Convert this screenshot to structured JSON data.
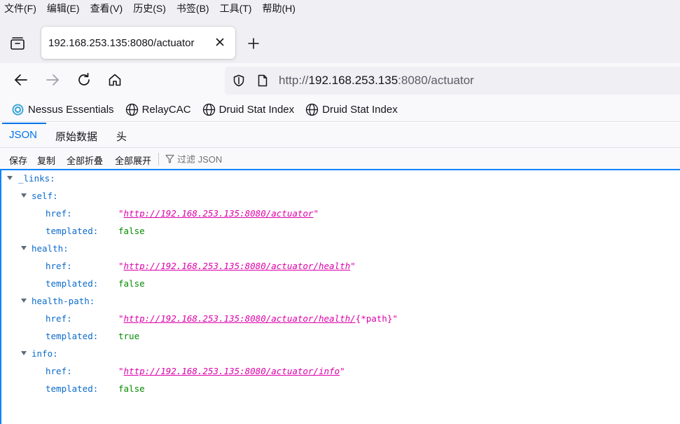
{
  "menubar": [
    "文件(F)",
    "编辑(E)",
    "查看(V)",
    "历史(S)",
    "书签(B)",
    "工具(T)",
    "帮助(H)"
  ],
  "tab": {
    "title": "192.168.253.135:8080/actuator"
  },
  "urlbar": {
    "scheme": "http://",
    "host": "192.168.253.135",
    "rest": ":8080/actuator"
  },
  "bookmarks": [
    {
      "label": "Nessus Essentials",
      "icon": "nessus-icon"
    },
    {
      "label": "RelayCAC",
      "icon": "globe-icon"
    },
    {
      "label": "Druid Stat Index",
      "icon": "globe-icon"
    },
    {
      "label": "Druid Stat Index",
      "icon": "globe-icon"
    }
  ],
  "viewer_tabs": [
    "JSON",
    "原始数据",
    "头"
  ],
  "toolbar": {
    "save": "保存",
    "copy": "复制",
    "collapse_all": "全部折叠",
    "expand_all": "全部展开",
    "filter_placeholder": "过滤 JSON"
  },
  "json": {
    "root_key": "_links:",
    "groups": [
      {
        "key": "self:",
        "href": "http://192.168.253.135:8080/actuator",
        "href_suffix": "",
        "templated": "false"
      },
      {
        "key": "health:",
        "href": "http://192.168.253.135:8080/actuator/health",
        "href_suffix": "",
        "templated": "false"
      },
      {
        "key": "health-path:",
        "href": "http://192.168.253.135:8080/actuator/health/",
        "href_suffix": "{*path}",
        "templated": "true"
      },
      {
        "key": "info:",
        "href": "http://192.168.253.135:8080/actuator/info",
        "href_suffix": "",
        "templated": "false"
      }
    ],
    "href_key": "href:",
    "templated_key": "templated:",
    "quote": "\""
  },
  "colors": {
    "accent": "#0074e8",
    "key": "#0b6bcc",
    "string": "#dd00a9",
    "boolean": "#058b00"
  }
}
